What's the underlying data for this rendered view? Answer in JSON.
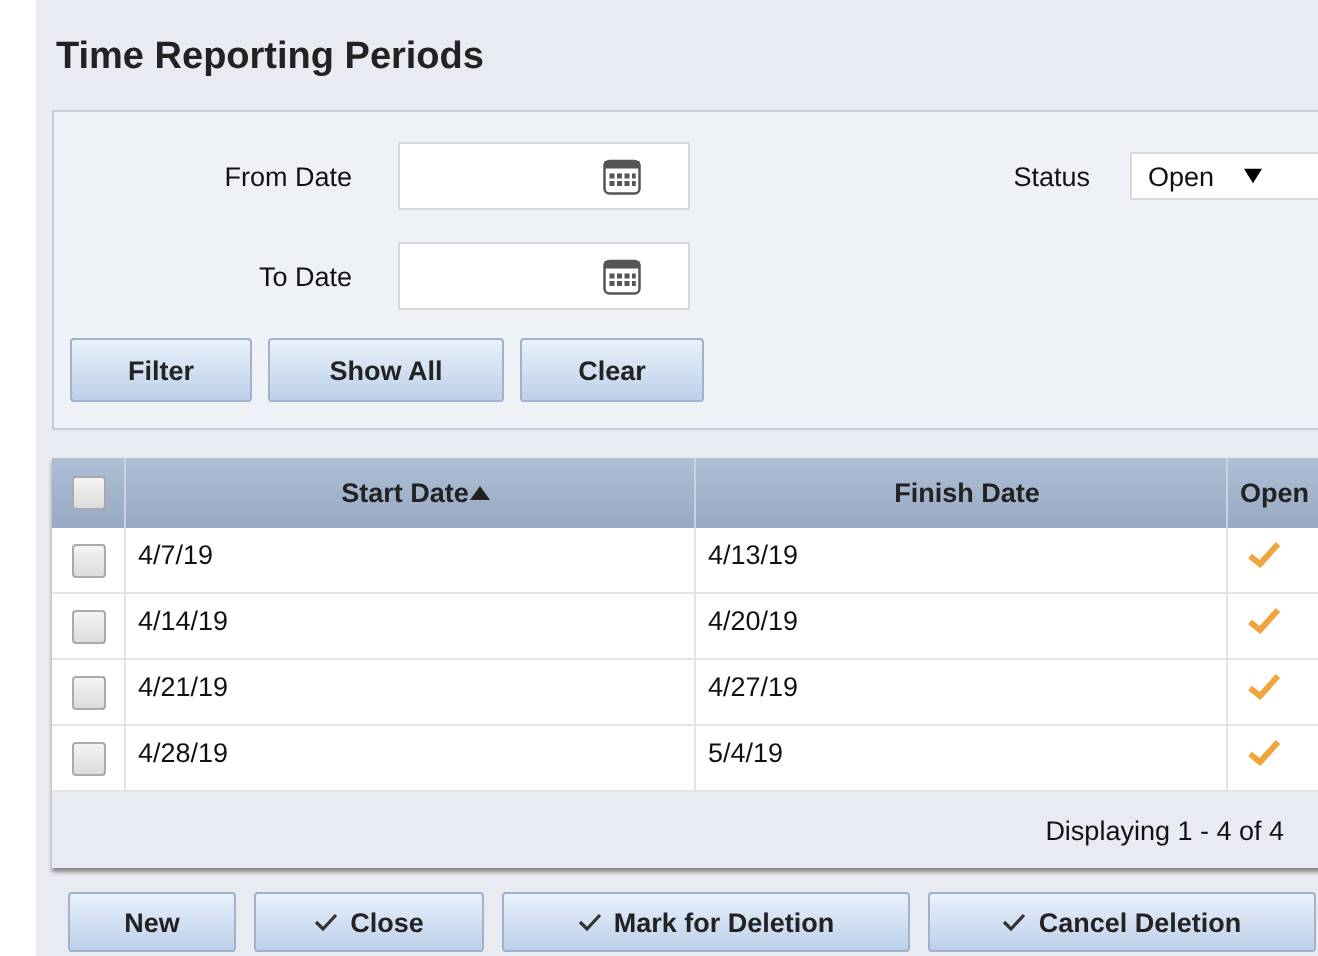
{
  "title": "Time Reporting Periods",
  "filter": {
    "from_label": "From Date",
    "to_label": "To Date",
    "status_label": "Status",
    "status_value": "Open",
    "buttons": [
      "Filter",
      "Show All",
      "Clear"
    ]
  },
  "table": {
    "select_all_checked": false,
    "columns": [
      "Start Date",
      "Finish Date",
      "Open"
    ],
    "rows": [
      {
        "checked": false,
        "start": "4/7/19",
        "finish": "4/13/19",
        "open": true
      },
      {
        "checked": false,
        "start": "4/14/19",
        "finish": "4/20/19",
        "open": true
      },
      {
        "checked": false,
        "start": "4/21/19",
        "finish": "4/27/19",
        "open": true
      },
      {
        "checked": false,
        "start": "4/28/19",
        "finish": "5/4/19",
        "open": true
      }
    ],
    "footer": "Displaying 1 - 4 of 4"
  },
  "actions": [
    {
      "label": "New",
      "icon": false
    },
    {
      "label": "Close",
      "icon": true
    },
    {
      "label": "Mark for Deletion",
      "icon": true
    },
    {
      "label": "Cancel Deletion",
      "icon": true
    }
  ]
}
